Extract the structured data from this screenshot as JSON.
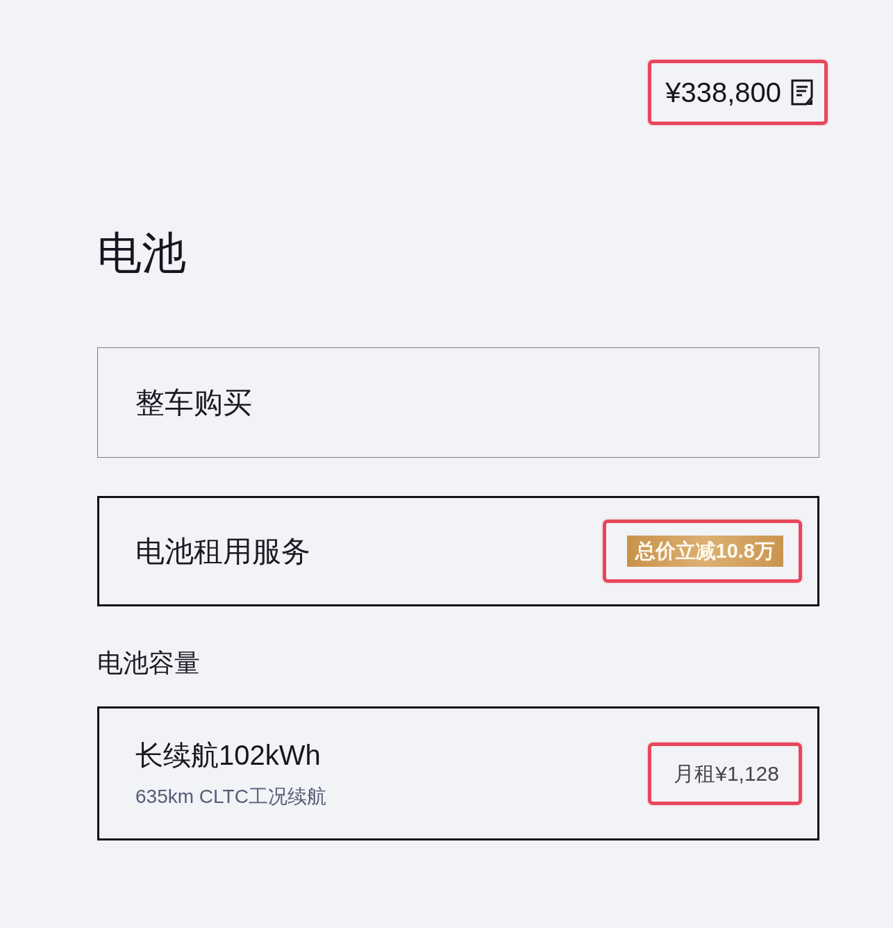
{
  "price": {
    "text": "¥338,800",
    "highlighted": true
  },
  "section_title": "电池",
  "purchase_options": [
    {
      "label": "整车购买",
      "selected": false
    },
    {
      "label": "电池租用服务",
      "selected": true,
      "badge": {
        "text": "总价立减10.8万",
        "highlighted": true
      }
    }
  ],
  "capacity": {
    "heading": "电池容量",
    "options": [
      {
        "title": "长续航102kWh",
        "subtitle": "635km CLTC工况续航",
        "selected": true,
        "price": {
          "text": "月租¥1,128",
          "highlighted": true
        }
      }
    ]
  }
}
